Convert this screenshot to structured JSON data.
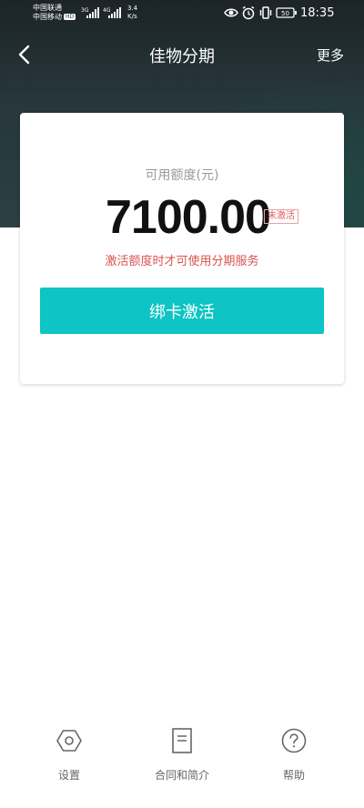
{
  "status_bar": {
    "carrier_1": "中国联通",
    "carrier_2": "中国移动",
    "hd_badge": "HD",
    "net_1": "3G",
    "net_2": "4G",
    "speed_value": "3.4",
    "speed_unit": "K/s",
    "battery": "50",
    "time": "18:35"
  },
  "nav": {
    "title": "佳物分期",
    "more_label": "更多"
  },
  "card": {
    "credit_label": "可用额度(元)",
    "amount": "7100.00",
    "status_badge": "未激活",
    "hint": "激活额度时才可使用分期服务",
    "activate_button": "绑卡激活"
  },
  "bottom_nav": {
    "items": [
      {
        "label": "设置",
        "icon": "settings-hexagon-icon"
      },
      {
        "label": "合同和简介",
        "icon": "document-icon"
      },
      {
        "label": "帮助",
        "icon": "help-icon"
      }
    ]
  },
  "colors": {
    "header_dark": "#27373b",
    "accent": "#0ec4c4",
    "warning": "#d9534f"
  }
}
